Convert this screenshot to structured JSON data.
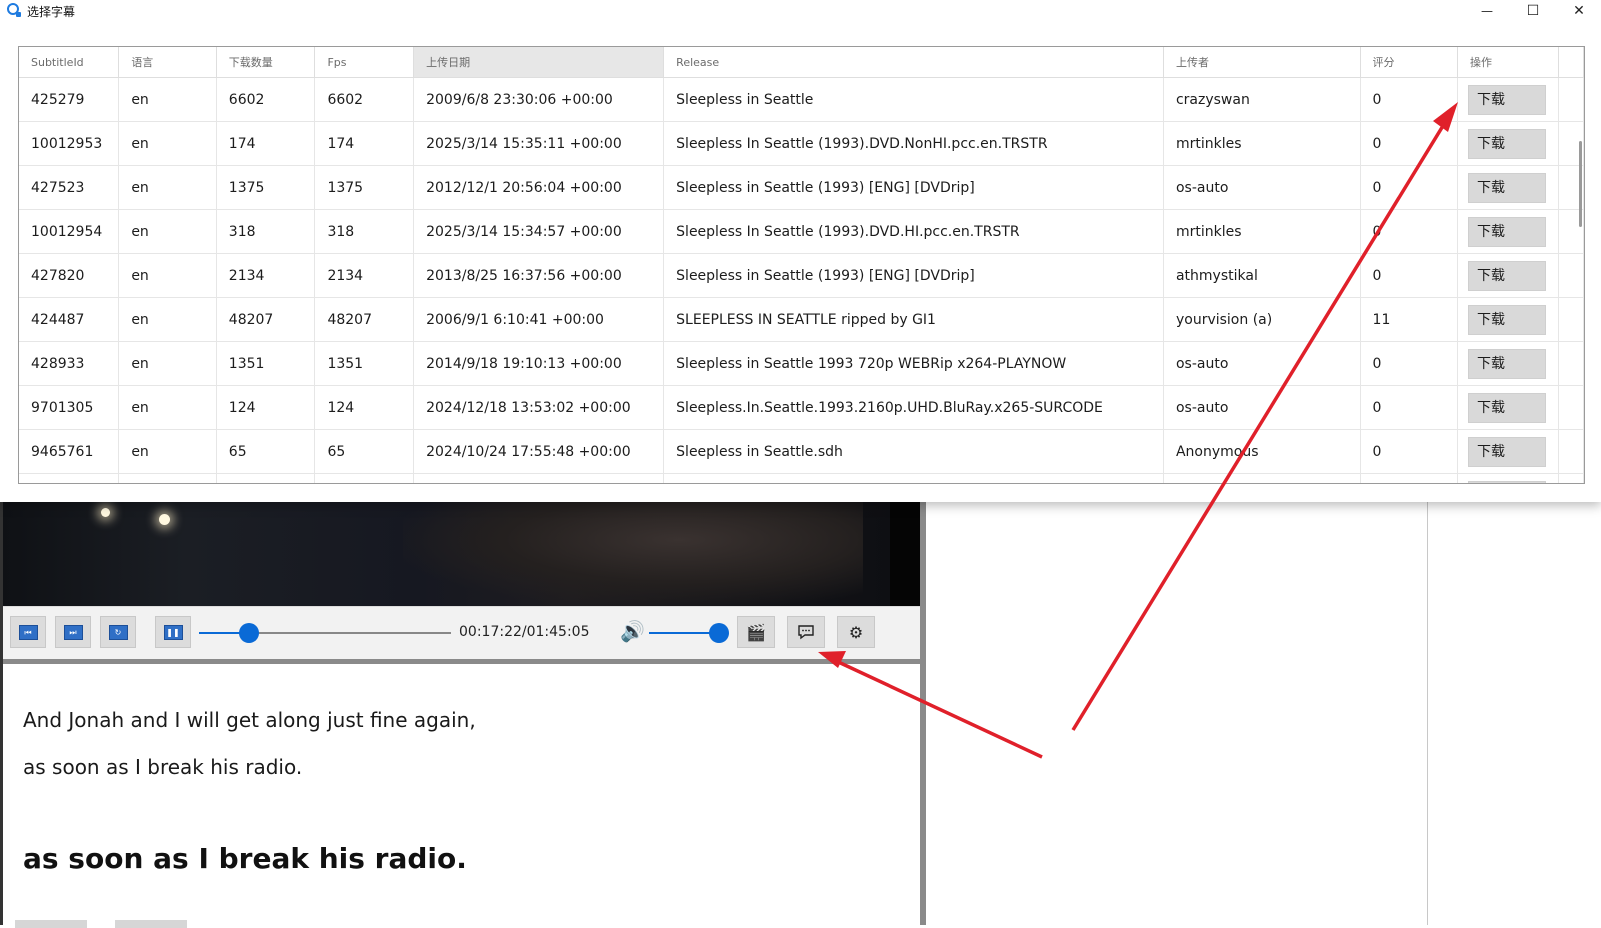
{
  "window": {
    "title": "选择字幕",
    "minimize_glyph": "—",
    "maximize_glyph": "☐",
    "close_glyph": "✕"
  },
  "table": {
    "columns": [
      "SubtitleId",
      "语言",
      "下载数量",
      "Fps",
      "上传日期",
      "Release",
      "上传者",
      "评分",
      "操作"
    ],
    "sorted_column": "上传日期",
    "download_label": "下载",
    "rows": [
      {
        "id": "425279",
        "lang": "en",
        "downloads": "6602",
        "fps": "6602",
        "date": "2009/6/8 23:30:06 +00:00",
        "release": "Sleepless in Seattle",
        "uploader": "crazyswan",
        "rating": "0"
      },
      {
        "id": "10012953",
        "lang": "en",
        "downloads": "174",
        "fps": "174",
        "date": "2025/3/14 15:35:11 +00:00",
        "release": "Sleepless In Seattle (1993).DVD.NonHI.pcc.en.TRSTR",
        "uploader": "mrtinkles",
        "rating": "0"
      },
      {
        "id": "427523",
        "lang": "en",
        "downloads": "1375",
        "fps": "1375",
        "date": "2012/12/1 20:56:04 +00:00",
        "release": "Sleepless in Seattle (1993) [ENG] [DVDrip]",
        "uploader": "os-auto",
        "rating": "0"
      },
      {
        "id": "10012954",
        "lang": "en",
        "downloads": "318",
        "fps": "318",
        "date": "2025/3/14 15:34:57 +00:00",
        "release": "Sleepless In Seattle (1993).DVD.HI.pcc.en.TRSTR",
        "uploader": "mrtinkles",
        "rating": "0"
      },
      {
        "id": "427820",
        "lang": "en",
        "downloads": "2134",
        "fps": "2134",
        "date": "2013/8/25 16:37:56 +00:00",
        "release": "Sleepless in Seattle (1993) [ENG] [DVDrip]",
        "uploader": "athmystikal",
        "rating": "0"
      },
      {
        "id": "424487",
        "lang": "en",
        "downloads": "48207",
        "fps": "48207",
        "date": "2006/9/1 6:10:41 +00:00",
        "release": "SLEEPLESS IN SEATTLE ripped by GI1",
        "uploader": "yourvision (a)",
        "rating": "11"
      },
      {
        "id": "428933",
        "lang": "en",
        "downloads": "1351",
        "fps": "1351",
        "date": "2014/9/18 19:10:13 +00:00",
        "release": "Sleepless in Seattle 1993 720p WEBRip x264-PLAYNOW",
        "uploader": "os-auto",
        "rating": "0"
      },
      {
        "id": "9701305",
        "lang": "en",
        "downloads": "124",
        "fps": "124",
        "date": "2024/12/18 13:53:02 +00:00",
        "release": "Sleepless.In.Seattle.1993.2160p.UHD.BluRay.x265-SURCODE",
        "uploader": "os-auto",
        "rating": "0"
      },
      {
        "id": "9465761",
        "lang": "en",
        "downloads": "65",
        "fps": "65",
        "date": "2024/10/24 17:55:48 +00:00",
        "release": "Sleepless in Seattle.sdh",
        "uploader": "Anonymous",
        "rating": "0"
      }
    ]
  },
  "player": {
    "time": "00:17:22/01:45:05",
    "progress_fraction": 0.2,
    "volume_fraction": 1.0,
    "prev_icon": "skip-previous-icon",
    "next_icon": "skip-next-icon",
    "repeat_icon": "repeat-icon",
    "pause_icon": "pause-icon",
    "volume_icon": "speaker-icon",
    "clapper_icon": "clapperboard-icon",
    "subtitle_icon": "subtitle-bubble-icon",
    "settings_icon": "gear-icon"
  },
  "subtitles": {
    "line1": "And Jonah and I will get along just fine again,",
    "line2": "as soon as I break his radio.",
    "current": "as soon as I break his radio."
  },
  "colors": {
    "accent": "#0a6ad6",
    "annotation_arrow": "#e0202a"
  }
}
